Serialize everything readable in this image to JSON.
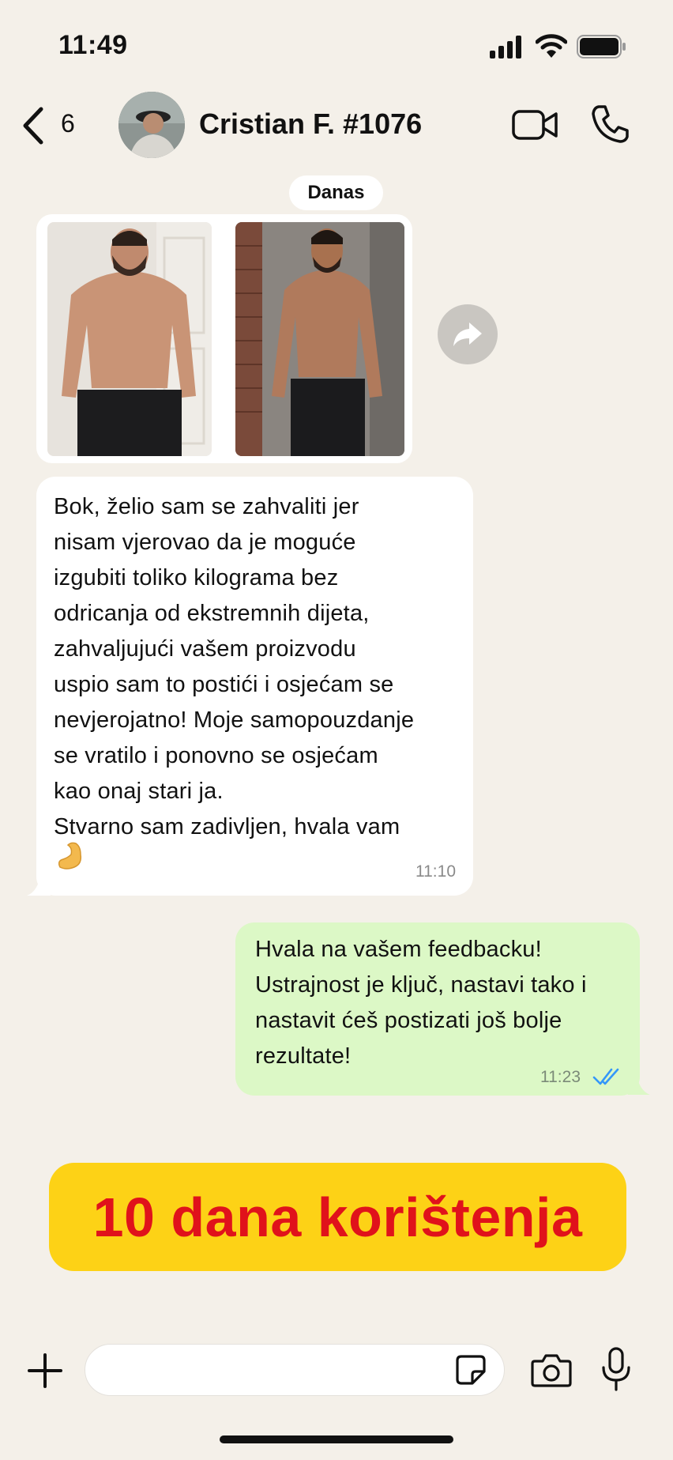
{
  "status_bar": {
    "time": "11:49"
  },
  "header": {
    "back_count": "6",
    "contact_name": "Cristian F. #1076"
  },
  "date_separator": "Danas",
  "incoming_message": {
    "lines": [
      "Bok, želio sam se zahvaliti jer",
      "nisam vjerovao da je moguće",
      "izgubiti toliko kilograma bez",
      "odricanja od ekstremnih dijeta,",
      "zahvaljujući vašem proizvodu",
      "uspio sam to postići i osjećam se",
      "nevjerojatno! Moje samopouzdanje",
      "se vratilo i ponovno se osjećam",
      "kao onaj stari ja.",
      "Stvarno sam zadivljen, hvala vam"
    ],
    "emoji": "💪",
    "time": "11:10"
  },
  "outgoing_message": {
    "lines": [
      "Hvala na vašem feedbacku!",
      "Ustrajnost je ključ, nastavi tako i",
      "nastavit ćeš postizati još bolje",
      "rezultate!"
    ],
    "time": "11:23",
    "status": "read"
  },
  "banner": {
    "text": "10 dana korištenja"
  },
  "colors": {
    "banner_bg": "#fdd216",
    "banner_text": "#e0121b",
    "outgoing_bubble": "#dcf8c6",
    "read_ticks": "#3497f9"
  }
}
